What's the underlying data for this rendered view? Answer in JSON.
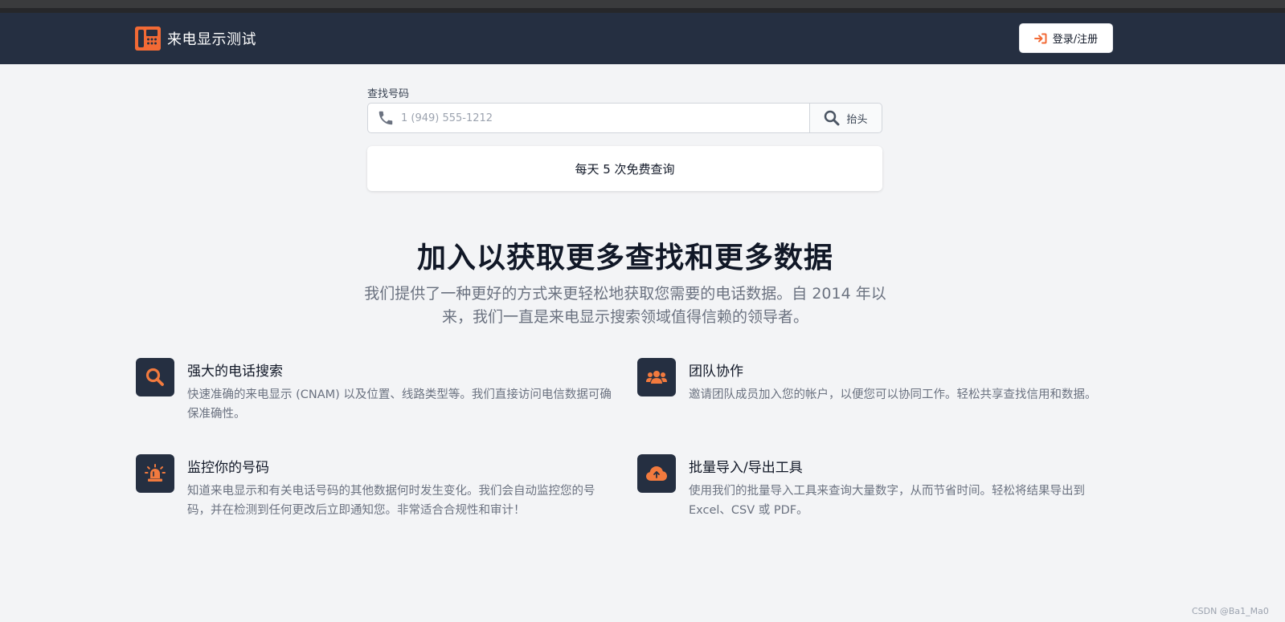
{
  "brand": {
    "name": "来电显示测试",
    "icon": "phone-logo-icon"
  },
  "nav": {
    "login_label": "登录/注册",
    "login_icon": "sign-in-icon"
  },
  "search": {
    "label": "查找号码",
    "placeholder": "1 (949) 555-1212",
    "button_label": "抬头",
    "phone_icon": "phone-icon",
    "search_icon": "search-icon"
  },
  "free_note": "每天 5 次免费查询",
  "hero": {
    "title": "加入以获取更多查找和更多数据",
    "subtitle": "我们提供了一种更好的方式来更轻松地获取您需要的电话数据。自 2014 年以来，我们一直是来电显示搜索领域值得信赖的领导者。"
  },
  "features": [
    {
      "icon": "magnifier-icon",
      "title": "强大的电话搜索",
      "desc": "快速准确的来电显示 (CNAM) 以及位置、线路类型等。我们直接访问电信数据可确保准确性。"
    },
    {
      "icon": "team-icon",
      "title": "团队协作",
      "desc": "邀请团队成员加入您的帐户，以便您可以协同工作。轻松共享查找信用和数据。"
    },
    {
      "icon": "alarm-icon",
      "title": "监控你的号码",
      "desc": "知道来电显示和有关电话号码的其他数据何时发生变化。我们会自动监控您的号码，并在检测到任何更改后立即通知您。非常适合合规性和审计！"
    },
    {
      "icon": "cloud-upload-icon",
      "title": "批量导入/导出工具",
      "desc": "使用我们的批量导入工具来查询大量数字，从而节省时间。轻松将结果导出到 Excel、CSV 或 PDF。"
    }
  ],
  "watermark": "CSDN @Ba1_Ma0",
  "colors": {
    "nav_bg": "#252f41",
    "accent": "#f26a35",
    "page_bg": "#f3f4f6"
  }
}
